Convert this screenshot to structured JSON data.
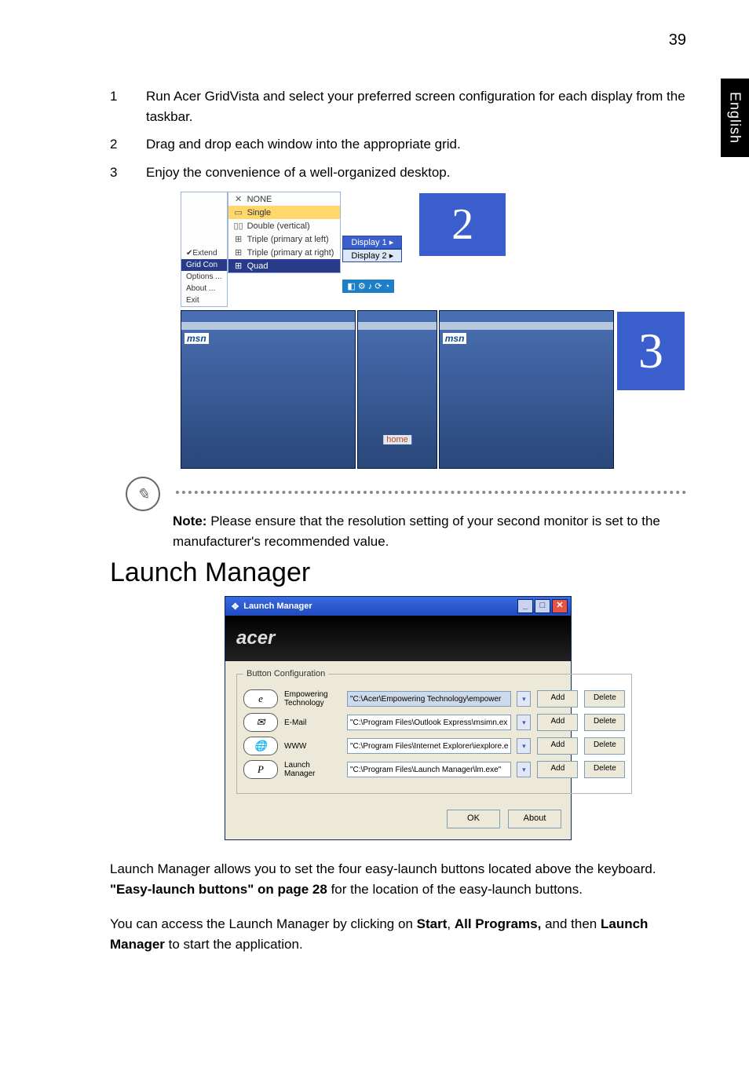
{
  "page_number": "39",
  "side_tab": "English",
  "steps": [
    "Run Acer GridVista and select your preferred screen configuration for each display from the taskbar.",
    "Drag and drop each window into the appropriate grid.",
    "Enjoy the convenience of a well-organized desktop."
  ],
  "gridvista": {
    "opts": {
      "none": "NONE",
      "single": "Single",
      "double_vertical": "Double (vertical)",
      "triple_left": "Triple (primary at left)",
      "triple_right": "Triple (primary at right)",
      "quad": "Quad"
    },
    "extend": "Extend",
    "grid_con": "Grid Con",
    "options": "Options ...",
    "about": "About ...",
    "exit": "Exit",
    "display1": "Display 1  ▸",
    "display2": "Display 2  ▸",
    "badge2": "2",
    "badge3": "3",
    "msn": "msn",
    "home": "home"
  },
  "note": {
    "label": "Note:",
    "text": "Please ensure that the resolution setting of your second monitor is set to the manufacturer's recommended value."
  },
  "section_title": "Launch Manager",
  "launch_window": {
    "title": "Launch Manager",
    "brand": "acer",
    "group_label": "Button Configuration",
    "rows": [
      {
        "key": "e",
        "label": "Empowering Technology",
        "path": "\"C:\\Acer\\Empowering Technology\\empower"
      },
      {
        "key": "✉",
        "label": "E-Mail",
        "path": "\"C:\\Program Files\\Outlook Express\\msimn.ex"
      },
      {
        "key": "🌐",
        "label": "WWW",
        "path": "\"C:\\Program Files\\Internet Explorer\\iexplore.e"
      },
      {
        "key": "P",
        "label": "Launch Manager",
        "path": "\"C:\\Program Files\\Launch Manager\\lm.exe\""
      }
    ],
    "add": "Add",
    "delete": "Delete",
    "ok": "OK",
    "about": "About"
  },
  "para1_a": "Launch Manager allows you to set the four easy-launch buttons located above the keyboard. ",
  "para1_b": "\"Easy-launch buttons\" on page 28",
  "para1_c": " for the location of the easy-launch buttons.",
  "para2_a": "You can access the Launch Manager by clicking on ",
  "para2_b": "Start",
  "para2_comma1": ", ",
  "para2_c": "All Programs,",
  "para2_d": " and then ",
  "para2_e": "Launch Manager",
  "para2_f": " to start the application."
}
